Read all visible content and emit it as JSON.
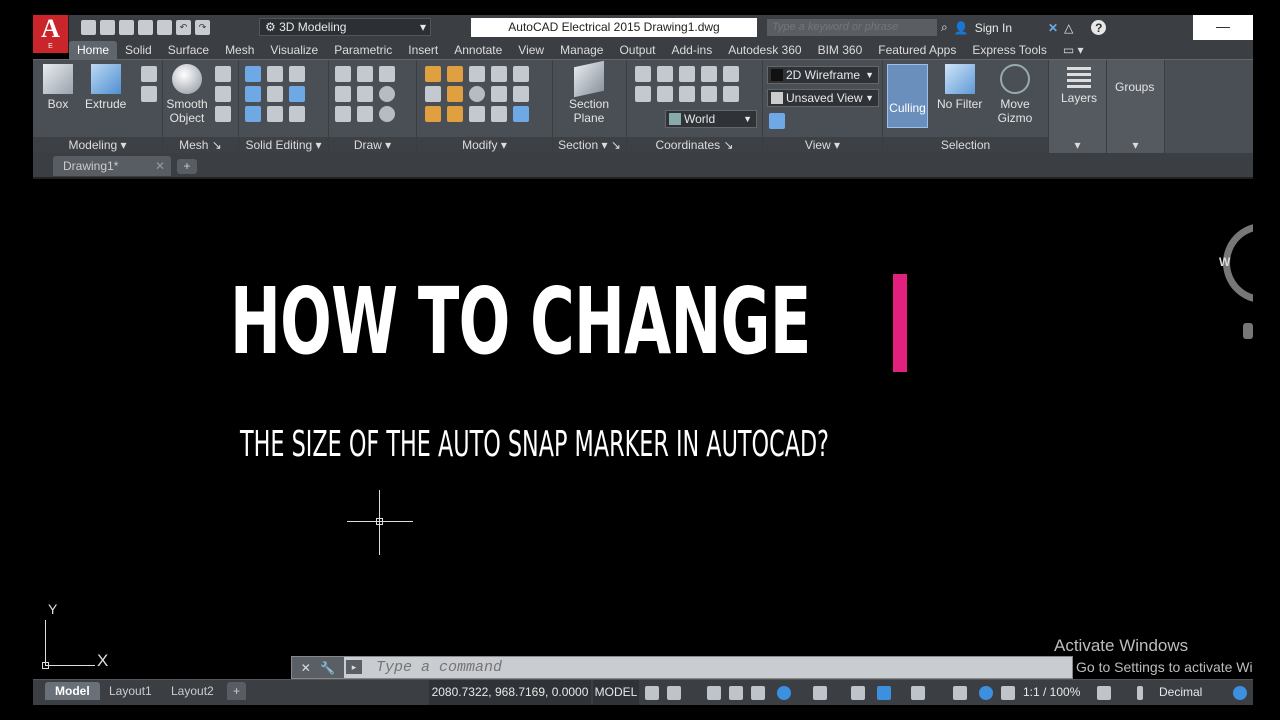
{
  "titlebar": {
    "app_logo_letter": "A",
    "app_logo_sub": "E",
    "workspace": "3D Modeling",
    "title": "AutoCAD Electrical 2015    Drawing1.dwg",
    "search_placeholder": "Type a keyword or phrase",
    "signin": "Sign In",
    "minimize": "—"
  },
  "ribbon_tabs": [
    "Home",
    "Solid",
    "Surface",
    "Mesh",
    "Visualize",
    "Parametric",
    "Insert",
    "Annotate",
    "View",
    "Manage",
    "Output",
    "Add-ins",
    "Autodesk 360",
    "BIM 360",
    "Featured Apps",
    "Express Tools"
  ],
  "ribbon": {
    "panels": {
      "modeling": "Modeling",
      "mesh": "Mesh",
      "solid_editing": "Solid Editing",
      "draw": "Draw",
      "modify": "Modify",
      "section": "Section",
      "coordinates": "Coordinates",
      "view": "View",
      "selection": "Selection"
    },
    "buttons": {
      "box": "Box",
      "extrude": "Extrude",
      "smooth_object": "Smooth Object",
      "section_plane": "Section Plane",
      "culling": "Culling",
      "no_filter": "No Filter",
      "move_gizmo": "Move Gizmo",
      "layers": "Layers",
      "groups": "Groups"
    },
    "combos": {
      "visual_style": "2D Wireframe",
      "named_view": "Unsaved View",
      "ucs": "World"
    }
  },
  "filetabs": {
    "doc": "Drawing1*",
    "new": "+"
  },
  "viewport": {
    "headline": "HOW TO CHANGE",
    "subline": "THE SIZE  OF THE AUTO SNAP MARKER IN AUTOCAD?",
    "ucs_y": "Y",
    "ucs_x": "X",
    "viewcube_label": "W"
  },
  "watermark": {
    "title": "Activate Windows",
    "subtitle": "Go to Settings to activate Windows."
  },
  "command_line": {
    "placeholder": "Type a command"
  },
  "statusbar": {
    "layout_tabs": [
      "Model",
      "Layout1",
      "Layout2"
    ],
    "add_layout": "+",
    "coordinates": "2080.7322, 968.7169, 0.0000",
    "model": "MODEL",
    "scale": "1:1 / 100%",
    "units": "Decimal"
  },
  "colors": {
    "accent_cursor": "#e2207e",
    "app_red": "#c9252b",
    "ribbon_bg": "#4a4f55"
  }
}
